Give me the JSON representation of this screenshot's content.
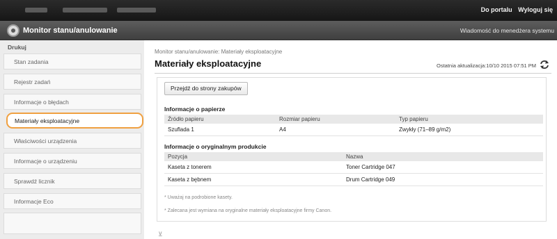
{
  "header": {
    "links": [
      "Do portalu",
      "Wyloguj się"
    ]
  },
  "titlebar": {
    "title": "Monitor stanu/anulowanie",
    "message_link": "Wiadomość do menedżera systemu"
  },
  "sidebar": {
    "heading": "Drukuj",
    "items": [
      {
        "label": "Stan zadania"
      },
      {
        "label": "Rejestr zadań"
      },
      {
        "label": "Informacje o błędach"
      },
      {
        "label": "Materiały eksploatacyjne"
      },
      {
        "label": "Właściwości urządzenia"
      },
      {
        "label": "Informacje o urządzeniu"
      },
      {
        "label": "Sprawdź licznik"
      },
      {
        "label": "Informacje Eco"
      }
    ],
    "active_index": 3
  },
  "main": {
    "breadcrumb": "Monitor stanu/anulowanie: Materiały eksploatacyjne",
    "title": "Materiały eksploatacyjne",
    "last_update": "Ostatnia aktualizacja:10/10 2015 07:51 PM",
    "buy_button": "Przejdź do strony zakupów",
    "paper": {
      "heading": "Informacje o papierze",
      "columns": [
        "Źródło papieru",
        "Rozmiar papieru",
        "Typ papieru"
      ],
      "rows": [
        [
          "Szuflada 1",
          "A4",
          "Zwykły (71–89 g/m2)"
        ]
      ]
    },
    "consumables": {
      "heading": "Informacje o oryginalnym produkcie",
      "columns": [
        "Pozycja",
        "Nazwa"
      ],
      "rows": [
        [
          "Kaseta z tonerem",
          "Toner Cartridge 047"
        ],
        [
          "Kaseta z bębnem",
          "Drum Cartridge 049"
        ]
      ]
    },
    "notes": [
      "* Uważaj na podrobione kasety.",
      "* Zalecana jest wymiana na oryginalne materiały eksploatacyjne firmy Canon."
    ]
  },
  "colors": {
    "accent_highlight": "#f0a040",
    "topbar": "#1f1f1f",
    "titlebar": "#4a4a4a"
  },
  "icons": [
    "monitor-logo-icon",
    "refresh-icon",
    "page-top-icon"
  ]
}
